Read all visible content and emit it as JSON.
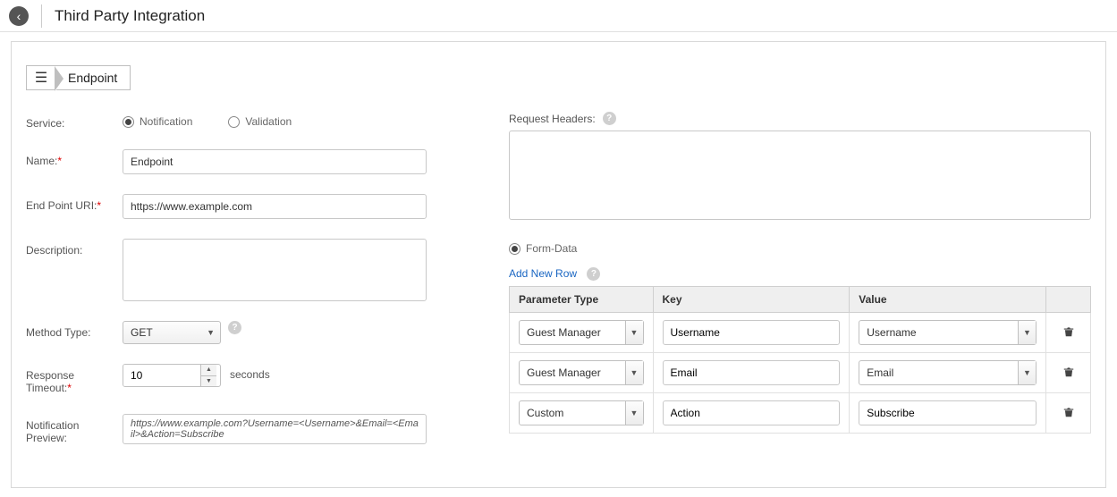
{
  "header": {
    "title": "Third Party Integration"
  },
  "breadcrumb": {
    "label": "Endpoint"
  },
  "left": {
    "service_label": "Service:",
    "service_options": {
      "notification": "Notification",
      "validation": "Validation"
    },
    "name_label": "Name:",
    "name_value": "Endpoint",
    "uri_label": "End Point URI:",
    "uri_value": "https://www.example.com",
    "desc_label": "Description:",
    "desc_value": "",
    "method_label": "Method Type:",
    "method_value": "GET",
    "timeout_label": "Response Timeout:",
    "timeout_value": "10",
    "timeout_unit": "seconds",
    "preview_label": "Notification Preview:",
    "preview_value": "https://www.example.com?Username=<Username>&Email=<Email>&Action=Subscribe"
  },
  "right": {
    "headers_label": "Request Headers:",
    "headers_value": "",
    "body_type_label": "Form-Data",
    "add_row_label": "Add New Row",
    "columns": {
      "param_type": "Parameter Type",
      "key": "Key",
      "value": "Value"
    },
    "rows": [
      {
        "param_type": "Guest Manager",
        "key": "Username",
        "value": "Username",
        "value_is_select": true
      },
      {
        "param_type": "Guest Manager",
        "key": "Email",
        "value": "Email",
        "value_is_select": true
      },
      {
        "param_type": "Custom",
        "key": "Action",
        "value": "Subscribe",
        "value_is_select": false
      }
    ]
  }
}
